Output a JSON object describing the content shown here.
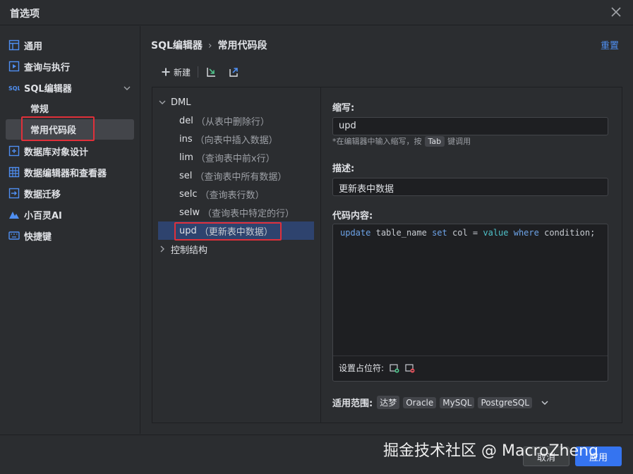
{
  "window": {
    "title": "首选项"
  },
  "sidebar": {
    "items": [
      {
        "label": "通用",
        "icon": "layout-icon"
      },
      {
        "label": "查询与执行",
        "icon": "query-run-icon"
      },
      {
        "label": "SQL编辑器",
        "icon": "sql-icon",
        "expanded": true,
        "children": [
          {
            "label": "常规"
          },
          {
            "label": "常用代码段",
            "selected": true
          }
        ]
      },
      {
        "label": "数据库对象设计",
        "icon": "db-object-icon"
      },
      {
        "label": "数据编辑器和查看器",
        "icon": "grid-icon"
      },
      {
        "label": "数据迁移",
        "icon": "migrate-icon"
      },
      {
        "label": "小百灵AI",
        "icon": "ai-icon"
      },
      {
        "label": "快捷键",
        "icon": "keyboard-icon"
      }
    ]
  },
  "breadcrumb": {
    "parent": "SQL编辑器",
    "current": "常用代码段"
  },
  "reset_label": "重置",
  "toolbar": {
    "new_label": "新建"
  },
  "tree": {
    "groups": [
      {
        "label": "DML",
        "expanded": true,
        "items": [
          {
            "abbr": "del",
            "desc": "（从表中删除行）"
          },
          {
            "abbr": "ins",
            "desc": "（向表中插入数据）"
          },
          {
            "abbr": "lim",
            "desc": "（查询表中前x行）"
          },
          {
            "abbr": "sel",
            "desc": "（查询表中所有数据）"
          },
          {
            "abbr": "selc",
            "desc": "（查询表行数）"
          },
          {
            "abbr": "selw",
            "desc": "（查询表中特定的行）"
          },
          {
            "abbr": "upd",
            "desc": "（更新表中数据）",
            "selected": true
          }
        ]
      },
      {
        "label": "控制结构",
        "expanded": false
      }
    ]
  },
  "detail": {
    "abbr_label": "缩写:",
    "abbr_value": "upd",
    "hint_before": "*在编辑器中输入缩写，按",
    "hint_key": "Tab",
    "hint_after": "键调用",
    "desc_label": "描述:",
    "desc_value": "更新表中数据",
    "code_label": "代码内容:",
    "code_tokens": [
      {
        "t": "update",
        "c": "kw"
      },
      {
        "t": " ",
        "c": "id"
      },
      {
        "t": "table_name",
        "c": "id"
      },
      {
        "t": " ",
        "c": "id"
      },
      {
        "t": "set",
        "c": "kw"
      },
      {
        "t": " ",
        "c": "id"
      },
      {
        "t": "col",
        "c": "id"
      },
      {
        "t": " = ",
        "c": "id"
      },
      {
        "t": "value",
        "c": "val"
      },
      {
        "t": " ",
        "c": "id"
      },
      {
        "t": "where",
        "c": "kw"
      },
      {
        "t": " ",
        "c": "id"
      },
      {
        "t": "condition;",
        "c": "id"
      }
    ],
    "placeholder_label": "设置占位符:",
    "scope_label": "适用范围:",
    "scope_tags": [
      "达梦",
      "Oracle",
      "MySQL",
      "PostgreSQL"
    ]
  },
  "footer": {
    "cancel_label": "取消",
    "apply_label": "应用"
  },
  "watermark": "掘金技术社区 @ MacroZheng",
  "colors": {
    "accent": "#3574f0",
    "link": "#4f8ff2",
    "highlight_box": "#e0303a",
    "selected_row": "#2e436e"
  }
}
